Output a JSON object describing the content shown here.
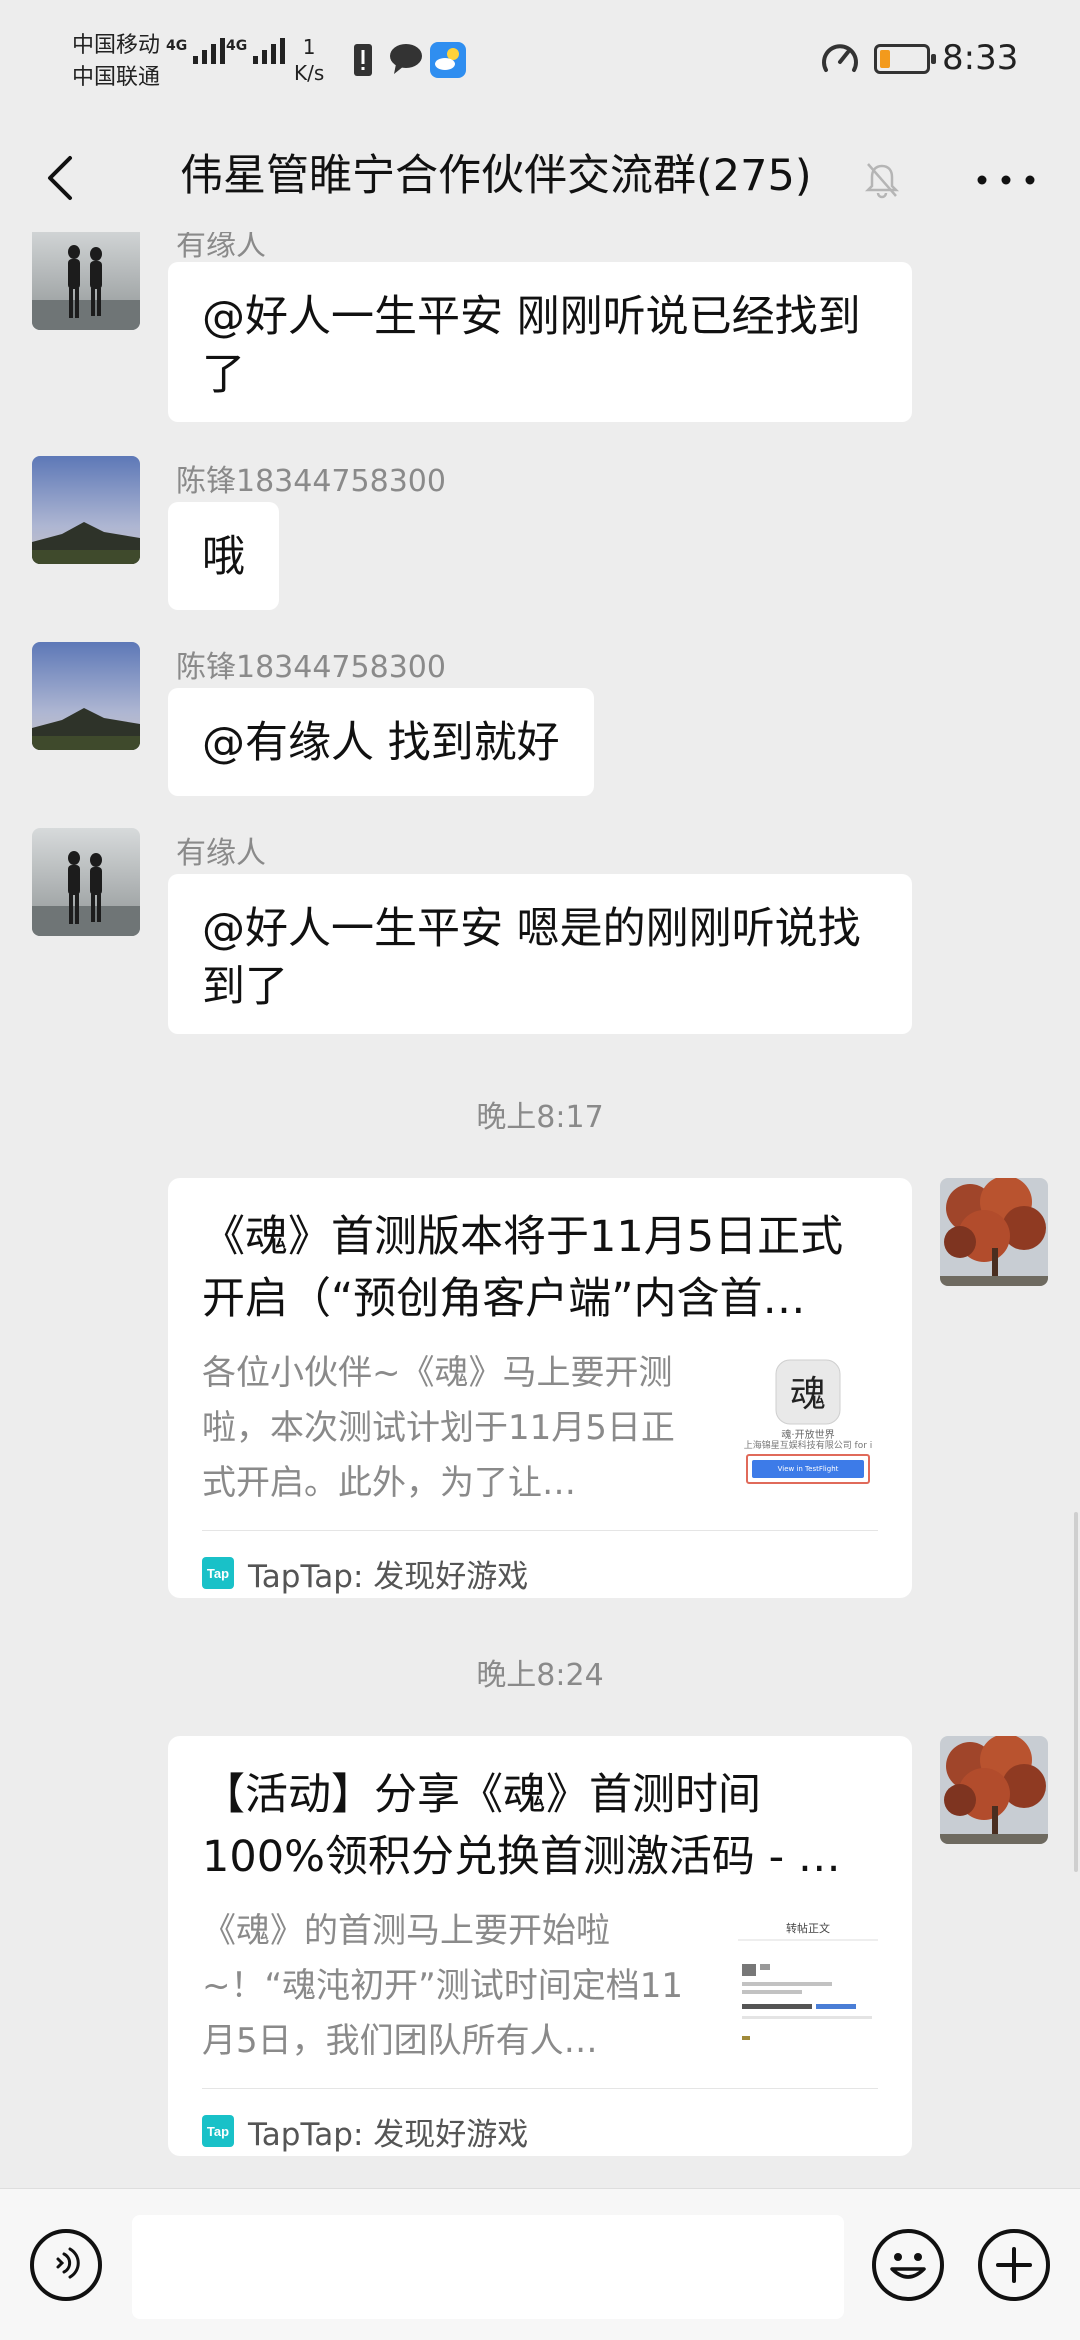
{
  "status_bar": {
    "carrier_1": "中国移动",
    "carrier_2": "中国联通",
    "network_tag": "4G",
    "net_speed_value": "1",
    "net_speed_unit": "K/s",
    "time": "8:33",
    "battery_level_percent": 20
  },
  "header": {
    "title": "伟星管睢宁合作伙伴交流群(275)"
  },
  "messages": [
    {
      "sender": "有缘人",
      "text": "@好人一生平安  刚刚听说已经找到了"
    },
    {
      "sender": "陈锋18344758300",
      "text": "哦"
    },
    {
      "sender": "陈锋18344758300",
      "text": "@有缘人  找到就好"
    },
    {
      "sender": "有缘人",
      "text": "@好人一生平安  嗯是的刚刚听说找到了"
    }
  ],
  "timestamps": [
    "晚上8:17",
    "晚上8:24"
  ],
  "cards": [
    {
      "title": "《魂》首测版本将于11月5日正式开启（“预创角客户端”内含首…",
      "desc": "各位小伙伴~《魂》马上要开测啦，本次测试计划于11月5日正式开启。此外，为了让…",
      "thumb_caption": "魂·开放世界",
      "thumb_company": "上海锦星互娱科技有限公司 for i",
      "thumb_button": "View in TestFlight",
      "source": "TapTap: 发现好游戏"
    },
    {
      "title": "【活动】分享《魂》首测时间100%领积分兑换首测激活码 - …",
      "desc": "《魂》的首测马上要开始啦~！“魂沌初开”测试时间定档11月5日，我们团队所有人…",
      "thumb_caption": "转帖正文",
      "source": "TapTap: 发现好游戏"
    }
  ],
  "tap_logo_text": "Tap",
  "input_bar": {
    "placeholder": ""
  },
  "colors": {
    "background": "#ededed",
    "bubble": "#ffffff",
    "taptap": "#19c1c8",
    "battery": "#f39a1c"
  }
}
